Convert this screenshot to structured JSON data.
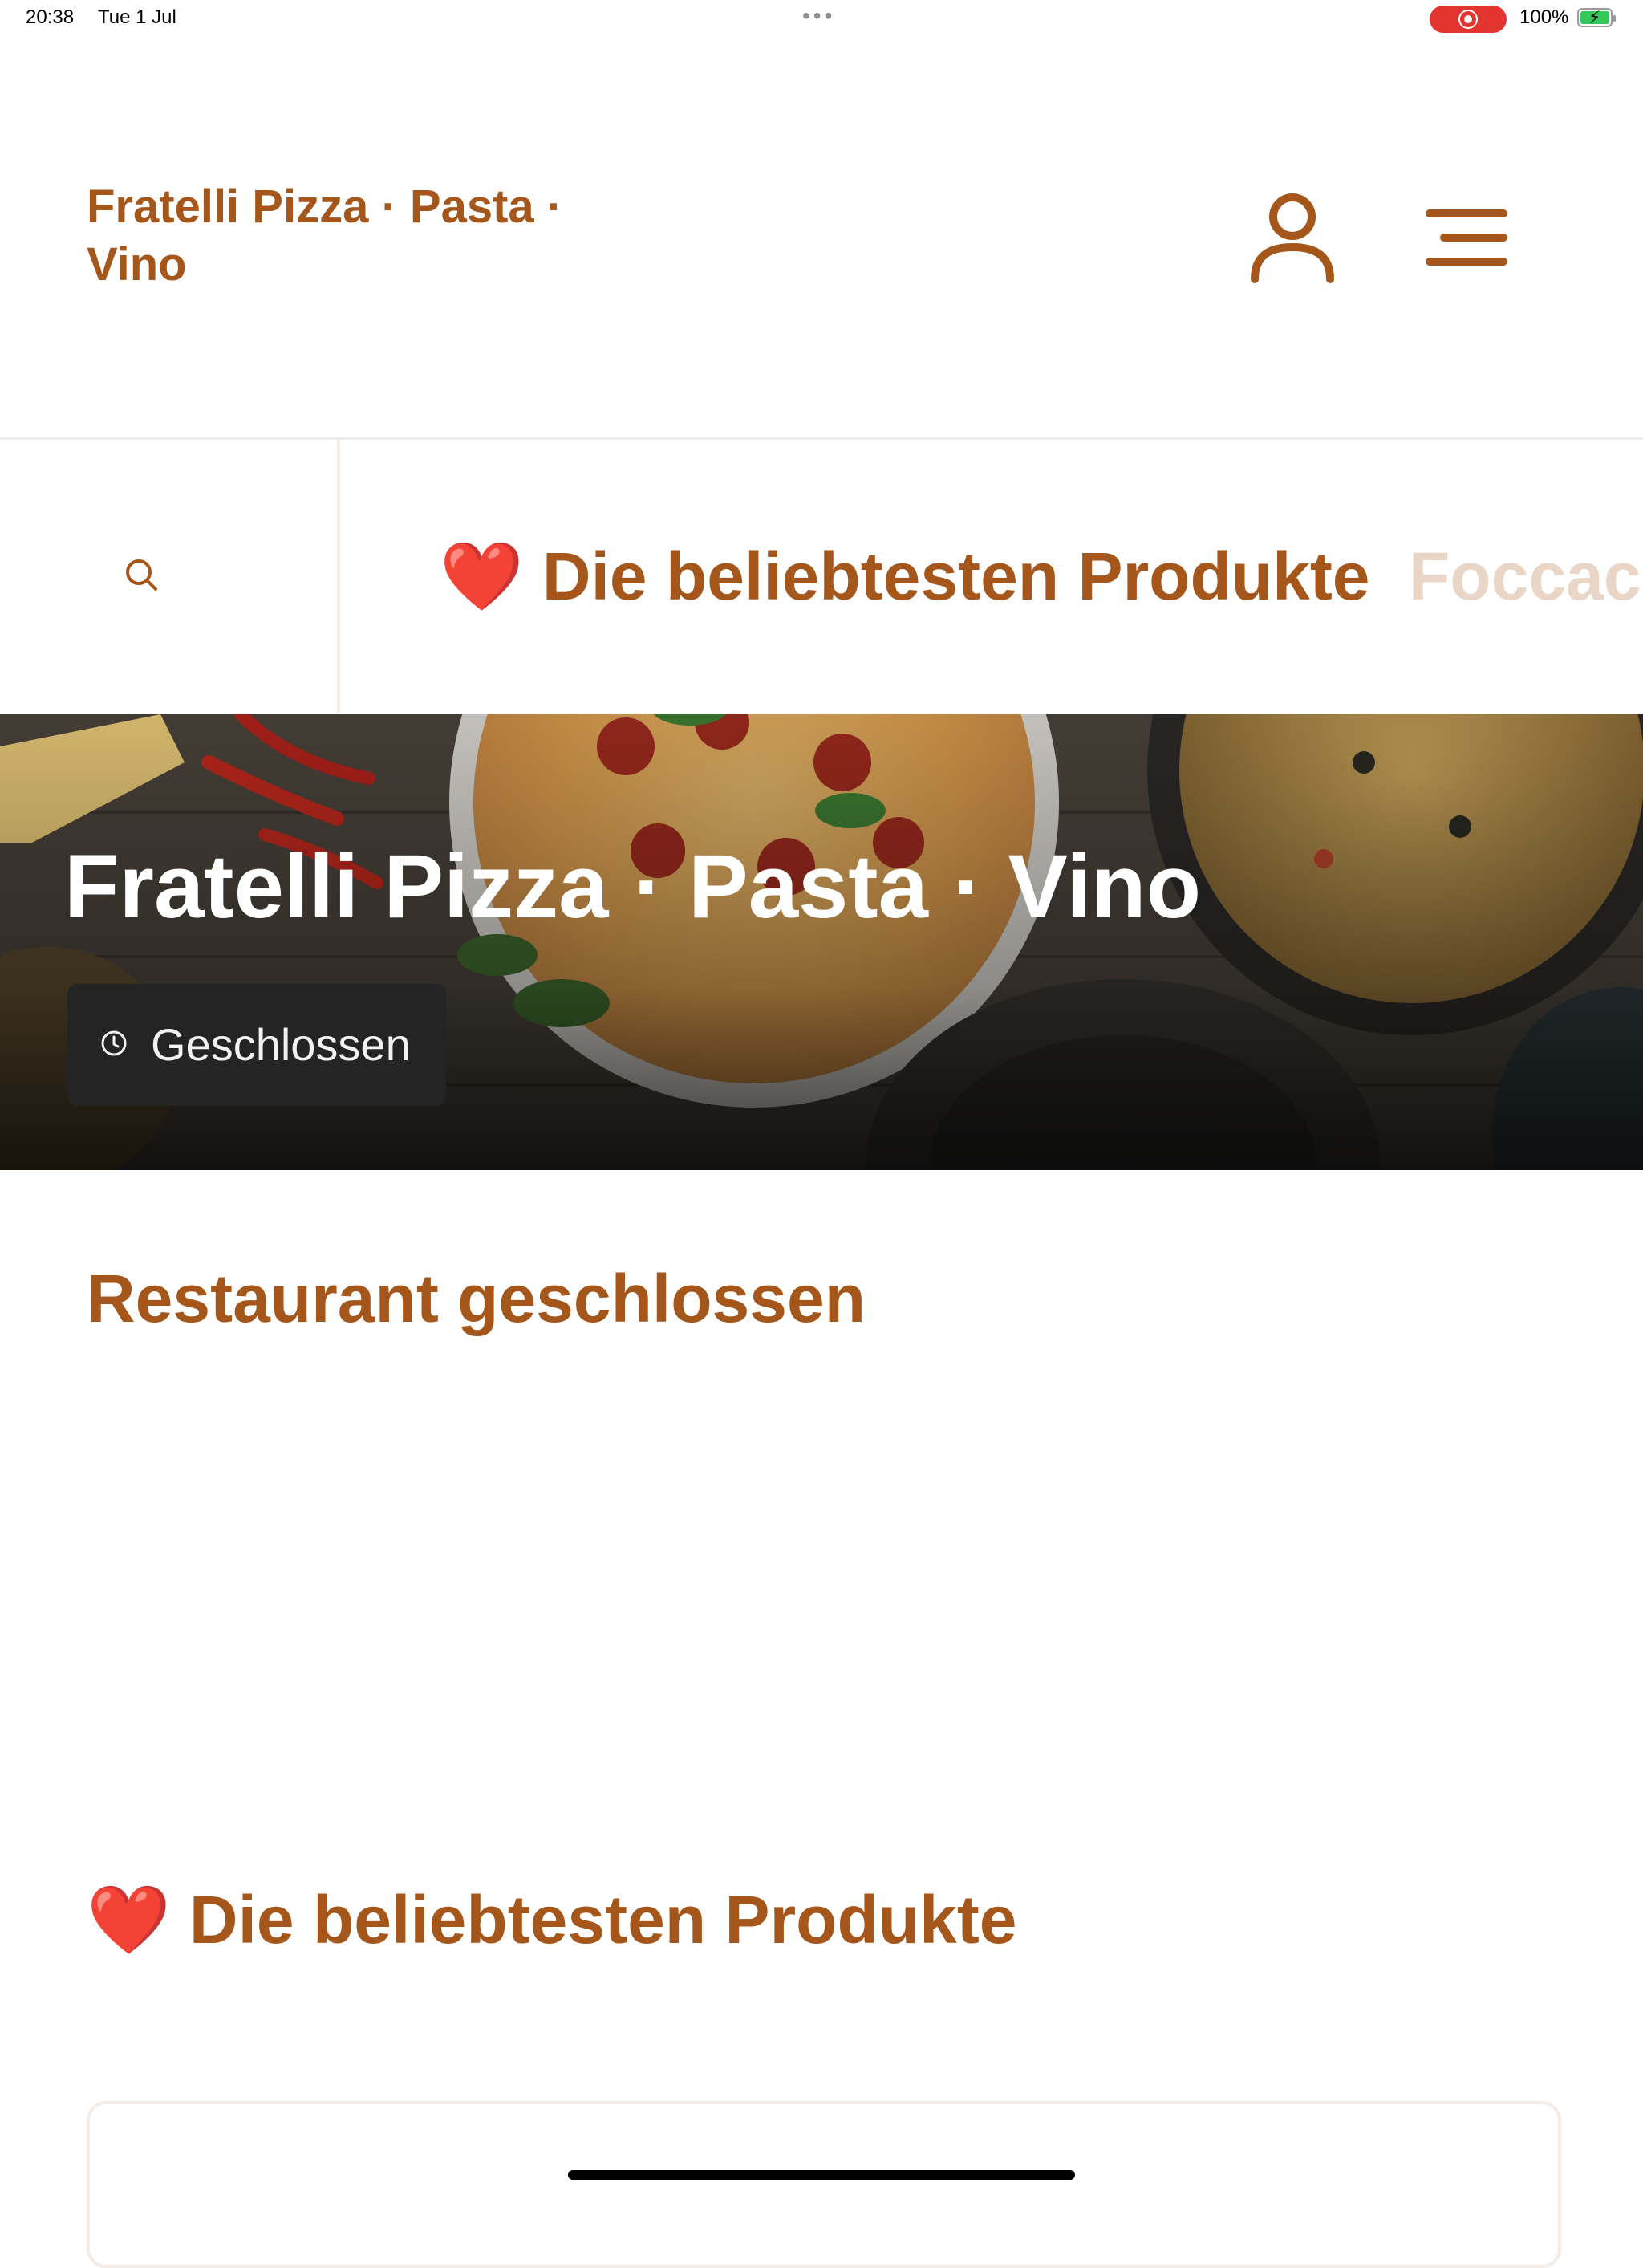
{
  "status_bar": {
    "time": "20:38",
    "date": "Tue 1 Jul",
    "battery": "100%"
  },
  "header": {
    "brand": "Fratelli Pizza · Pasta · Vino",
    "user_icon": "user-icon",
    "menu_icon": "menu-icon"
  },
  "category_nav": {
    "search_icon": "search-icon",
    "items": [
      {
        "label": "❤️ Die beliebtesten Produkte"
      },
      {
        "label": "Foccac"
      }
    ]
  },
  "hero": {
    "title": "Fratelli Pizza · Pasta · Vino",
    "status": "Geschlossen"
  },
  "main": {
    "closed_heading": "Restaurant geschlossen",
    "section_heading": "❤️ Die beliebtesten Produkte"
  },
  "colors": {
    "accent": "#a5561a",
    "accent_faded": "#ead6c6"
  }
}
